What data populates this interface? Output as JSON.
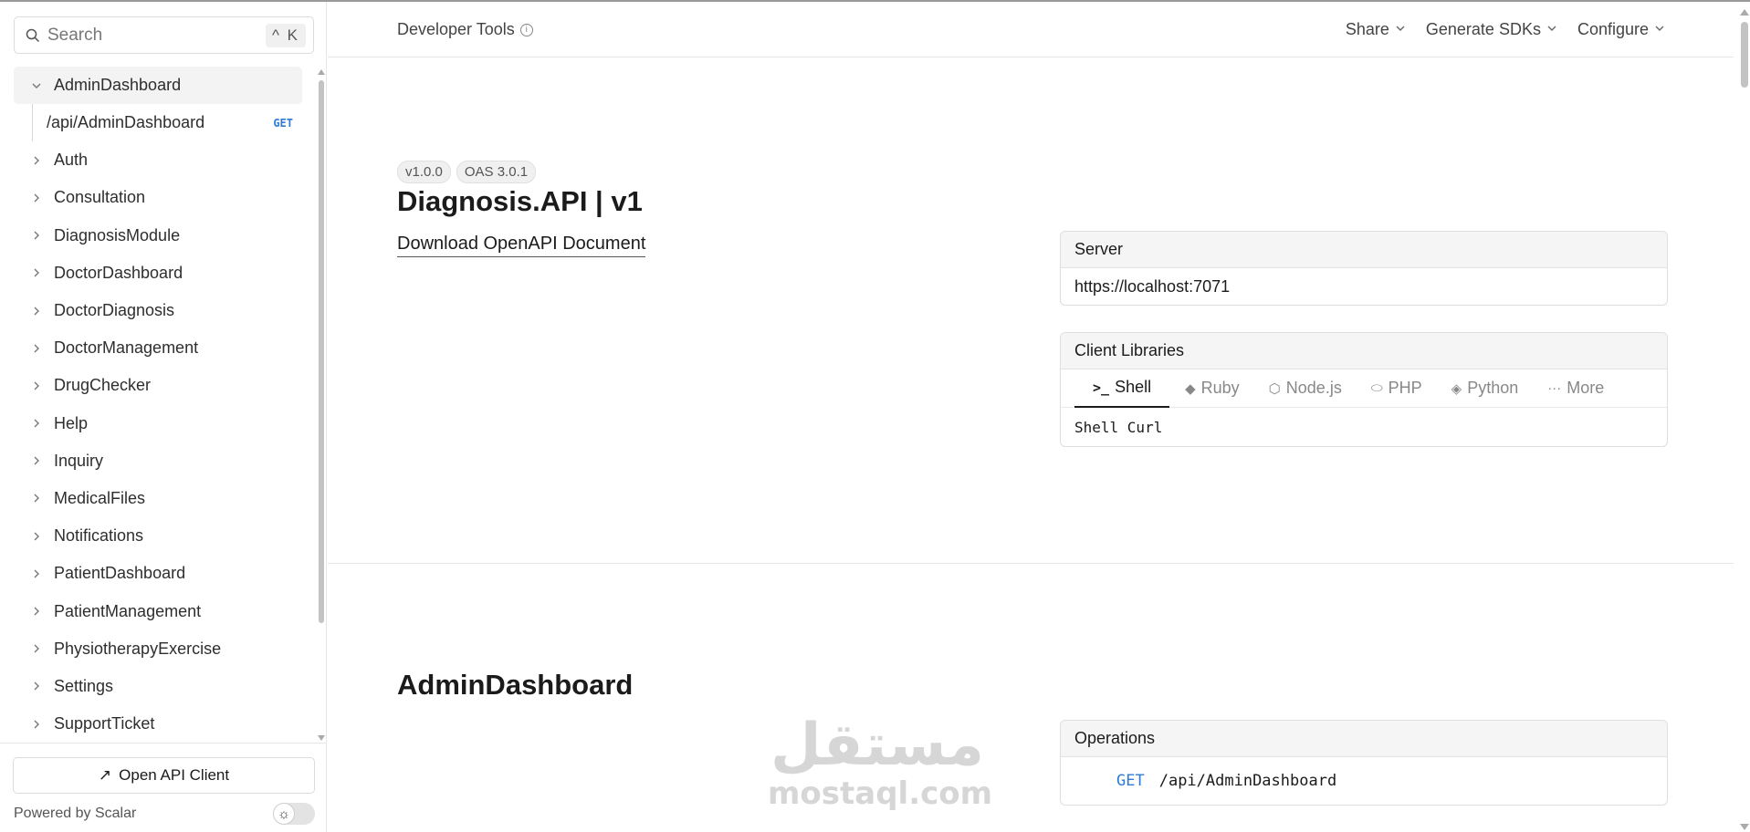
{
  "sidebar": {
    "search_placeholder": "Search",
    "search_shortcut": "^ K",
    "items": [
      {
        "label": "AdminDashboard",
        "expanded": true,
        "children": [
          {
            "path": "/api/AdminDashboard",
            "method": "GET"
          }
        ]
      },
      {
        "label": "Auth"
      },
      {
        "label": "Consultation"
      },
      {
        "label": "DiagnosisModule"
      },
      {
        "label": "DoctorDashboard"
      },
      {
        "label": "DoctorDiagnosis"
      },
      {
        "label": "DoctorManagement"
      },
      {
        "label": "DrugChecker"
      },
      {
        "label": "Help"
      },
      {
        "label": "Inquiry"
      },
      {
        "label": "MedicalFiles"
      },
      {
        "label": "Notifications"
      },
      {
        "label": "PatientDashboard"
      },
      {
        "label": "PatientManagement"
      },
      {
        "label": "PhysiotherapyExercise"
      },
      {
        "label": "Settings"
      },
      {
        "label": "SupportTicket"
      }
    ],
    "open_client_label": "Open API Client",
    "powered_by": "Powered by Scalar"
  },
  "header": {
    "developer_tools": "Developer Tools",
    "share": "Share",
    "generate_sdks": "Generate SDKs",
    "configure": "Configure"
  },
  "main": {
    "version_badge": "v1.0.0",
    "oas_badge": "OAS 3.0.1",
    "title": "Diagnosis.API | v1",
    "download_link": "Download OpenAPI Document",
    "server": {
      "header": "Server",
      "url": "https://localhost:7071"
    },
    "client_libraries": {
      "header": "Client Libraries",
      "tabs": [
        {
          "label": "Shell",
          "icon": "terminal-icon",
          "selected": true
        },
        {
          "label": "Ruby",
          "icon": "ruby-icon"
        },
        {
          "label": "Node.js",
          "icon": "nodejs-icon"
        },
        {
          "label": "PHP",
          "icon": "php-icon"
        },
        {
          "label": "Python",
          "icon": "python-icon"
        },
        {
          "label": "More",
          "icon": "more-icon"
        }
      ],
      "selected_client": "Shell Curl"
    },
    "section_title": "AdminDashboard",
    "operations": {
      "header": "Operations",
      "rows": [
        {
          "method": "GET",
          "path": "/api/AdminDashboard"
        }
      ]
    }
  },
  "watermark": {
    "arabic": "مستقل",
    "latin": "mostaql.com"
  },
  "colors": {
    "accent_get": "#2f7bd6",
    "border": "#dedede",
    "card_header_bg": "#f5f5f5"
  }
}
